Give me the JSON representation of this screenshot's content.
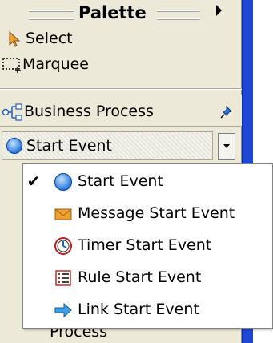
{
  "palette": {
    "title": "Palette",
    "tools": [
      {
        "label": "Select",
        "icon": "arrow-pointer-icon"
      },
      {
        "label": "Marquee",
        "icon": "marquee-icon"
      }
    ],
    "drawer": {
      "label": "Business Process",
      "icon": "process-tree-icon",
      "pin_icon": "pin-icon"
    },
    "combo": {
      "selected": "Start Event",
      "icon": "start-event-icon"
    },
    "behind_text": "Process"
  },
  "menu": {
    "items": [
      {
        "label": "Start Event",
        "icon": "start-event-icon",
        "checked": true
      },
      {
        "label": "Message Start Event",
        "icon": "envelope-icon",
        "checked": false
      },
      {
        "label": "Timer Start Event",
        "icon": "timer-icon",
        "checked": false
      },
      {
        "label": "Rule Start Event",
        "icon": "rule-list-icon",
        "checked": false
      },
      {
        "label": "Link Start Event",
        "icon": "link-arrow-icon",
        "checked": false
      }
    ]
  },
  "colors": {
    "panel": "#ece9d8",
    "editor_blue": "#1f47d3",
    "start_event_blue": "#2e7fe6",
    "envelope_orange": "#f0a030",
    "link_arrow_blue": "#3aa0e8"
  }
}
